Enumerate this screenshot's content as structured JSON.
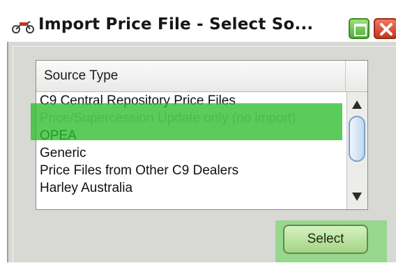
{
  "window": {
    "title": "Import Price File - Select So...",
    "app_icon": "motorcycle-icon",
    "controls": {
      "maximize": "maximize-icon",
      "close": "close-icon"
    }
  },
  "list": {
    "column_header": "Source Type",
    "items": [
      "C9 Central Repository Price Files",
      "Price/Supercession Update only (no import)",
      "OPEA",
      "Generic",
      "Price Files from Other C9 Dealers",
      "Harley Australia"
    ],
    "selected_index": 1
  },
  "actions": {
    "select_label": "Select"
  },
  "colors": {
    "highlight_green": "#2dbe2d",
    "button_green": "#a4d486",
    "close_red": "#c4361f",
    "maximize_green": "#4fae37"
  }
}
